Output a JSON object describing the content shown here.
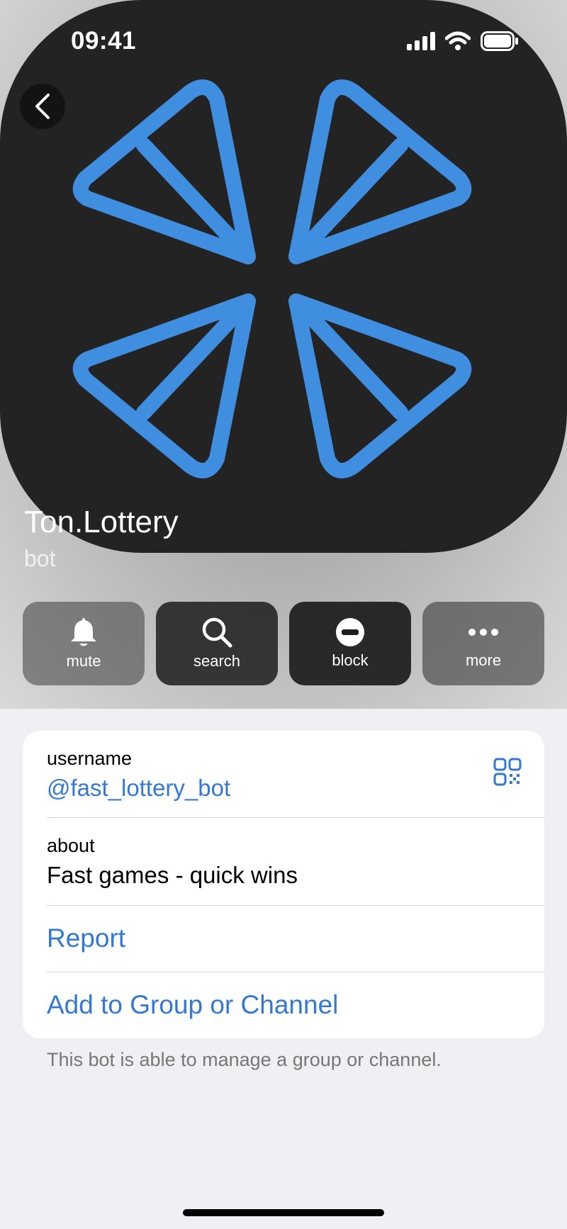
{
  "status_bar": {
    "time": "09:41"
  },
  "profile": {
    "name": "Ton.Lottery",
    "subtitle": "bot"
  },
  "actions": [
    {
      "label": "mute",
      "icon": "bell-icon"
    },
    {
      "label": "search",
      "icon": "search-icon"
    },
    {
      "label": "block",
      "icon": "block-icon"
    },
    {
      "label": "more",
      "icon": "more-icon"
    }
  ],
  "info": {
    "username_label": "username",
    "username": "@fast_lottery_bot",
    "about_label": "about",
    "about": "Fast games - quick wins",
    "report": "Report",
    "add_to_group": "Add to Group or Channel"
  },
  "footer_note": "This bot is able to manage a group or channel.",
  "colors": {
    "accent": "#3478d6",
    "logo_blue": "#3f8ee0",
    "avatar_bg": "#232323",
    "page_bg": "#efeff4"
  }
}
